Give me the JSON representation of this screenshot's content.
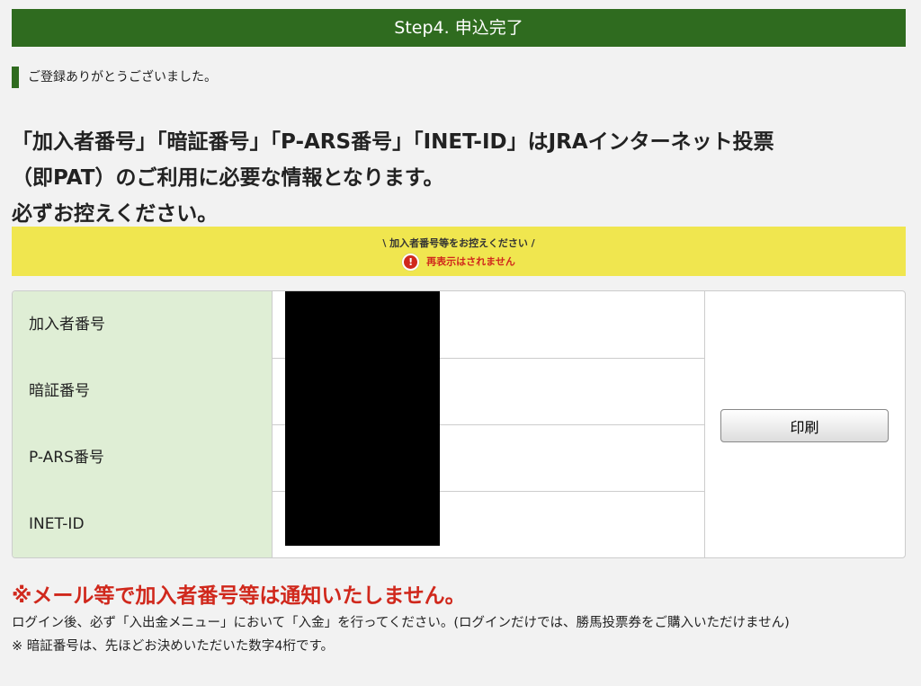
{
  "header": {
    "title": "Step4. 申込完了"
  },
  "thanks": "ご登録ありがとうございました。",
  "lead": {
    "line1": "「加入者番号」「暗証番号」「P-ARS番号」「INET-ID」はJRAインターネット投票",
    "line2": "（即PAT）のご利用に必要な情報となります。",
    "line3": "必ずお控えください。"
  },
  "banner": {
    "line1": "\\ 加入者番号等をお控えください /",
    "line2": "再表示はされません",
    "icon": "!"
  },
  "table": {
    "rows": [
      {
        "label": "加入者番号"
      },
      {
        "label": "暗証番号"
      },
      {
        "label": "P-ARS番号"
      },
      {
        "label": "INET-ID"
      }
    ],
    "print_label": "印刷"
  },
  "warning": "※メール等で加入者番号等は通知いたしません。",
  "notes": [
    "ログイン後、必ず「入出金メニュー」において「入金」を行ってください。(ログインだけでは、勝馬投票券をご購入いただけません)",
    "※ 暗証番号は、先ほどお決めいただいた数字4桁です。"
  ]
}
